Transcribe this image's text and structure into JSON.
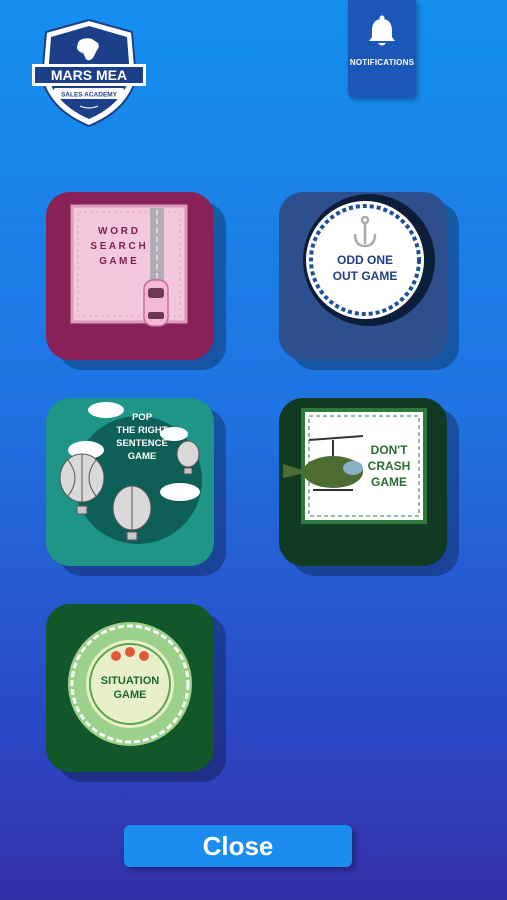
{
  "logo": {
    "name": "MARS MEA",
    "subtitle": "SALES ACADEMY"
  },
  "notifications": {
    "label": "NOTIFICATIONS",
    "icon": "bell-icon"
  },
  "games": [
    {
      "id": "word-search",
      "title": "WORD SEARCH GAME",
      "lines": [
        "W O R D",
        "S E A R C H",
        "G A M E"
      ],
      "color": "#8a2058"
    },
    {
      "id": "odd-one-out",
      "title": "ODD ONE OUT GAME",
      "lines": [
        "ODD ONE",
        "OUT GAME"
      ],
      "color": "#2e4f8e"
    },
    {
      "id": "pop-the-right-sentence",
      "title": "POP THE RIGHT SENTENCE GAME",
      "lines": [
        "POP",
        "THE RIGHT",
        "SENTENCE",
        "GAME"
      ],
      "color": "#1f9587"
    },
    {
      "id": "dont-crash",
      "title": "DON'T CRASH GAME",
      "lines": [
        "DON'T",
        "CRASH",
        "GAME"
      ],
      "color": "#113a22"
    },
    {
      "id": "situation",
      "title": "SITUATION GAME",
      "lines": [
        "SITUATION",
        "GAME"
      ],
      "color": "#12572a"
    }
  ],
  "close_button": {
    "label": "Close"
  }
}
